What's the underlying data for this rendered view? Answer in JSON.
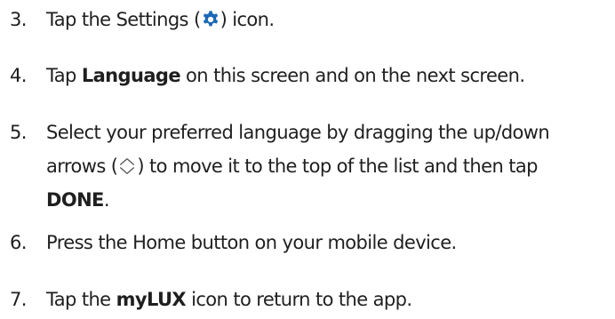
{
  "steps": [
    {
      "number": "3.",
      "segments": [
        "Tap the Settings (",
        ") icon."
      ],
      "icon": "gear-icon",
      "icon_color": "#1c68b5"
    },
    {
      "number": "4.",
      "segments": [
        "Tap ",
        "Language",
        " on this screen and on the next screen."
      ]
    },
    {
      "number": "5.",
      "lines": [
        [
          "Select your preferred language by dragging the up/down"
        ],
        [
          "arrows (",
          ") to move it to the top of the list and then tap"
        ],
        [
          "DONE",
          "."
        ]
      ],
      "icon": "up-down-arrows-icon"
    },
    {
      "number": "6.",
      "segments": [
        "Press the Home button on your mobile device."
      ]
    },
    {
      "number": "7.",
      "segments": [
        "Tap the ",
        "myLUX",
        " icon to return to the app."
      ]
    }
  ]
}
